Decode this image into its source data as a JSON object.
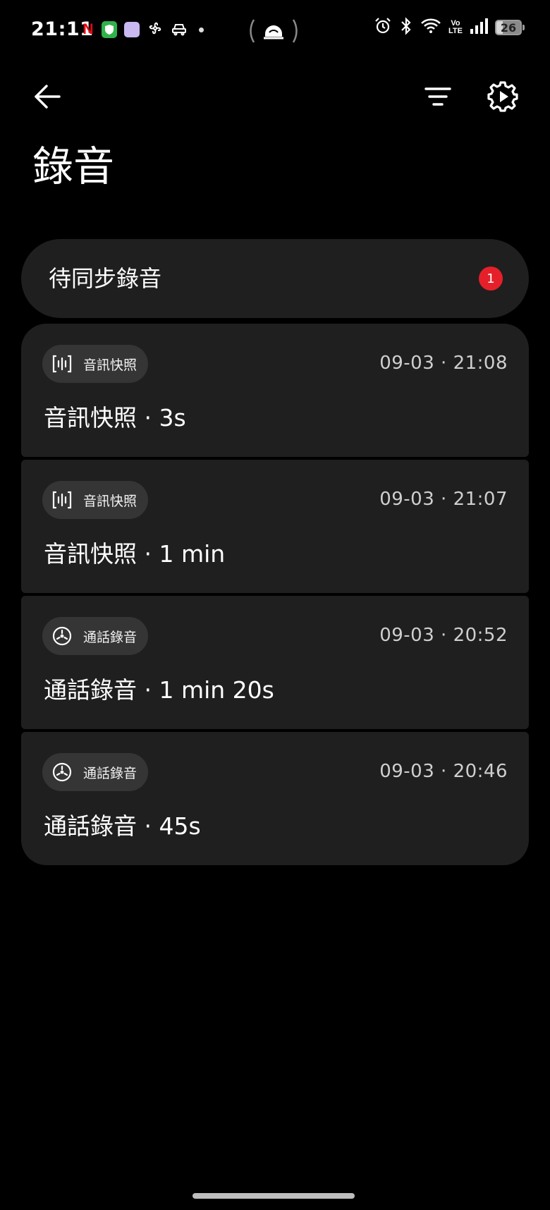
{
  "status_bar": {
    "time": "21:11",
    "netflix_glyph": "N",
    "battery_level": "26",
    "volte_label": "Vo\nLTE",
    "left_icons": [
      "netflix-icon",
      "shield-icon",
      "app-icon",
      "fan-icon",
      "car-icon",
      "dot-icon"
    ],
    "center_icon": "hotspot-icon",
    "right_icons": [
      "alarm-icon",
      "bluetooth-icon",
      "wifi-icon",
      "volte-icon",
      "signal-icon",
      "battery-icon"
    ]
  },
  "app_bar": {
    "back_icon": "arrow-left-icon",
    "filter_icon": "filter-icon",
    "settings_icon": "settings-gear-icon",
    "title": "錄音"
  },
  "pending_sync": {
    "label": "待同步錄音",
    "badge_count": "1",
    "badge_color": "#e5202a"
  },
  "recordings": [
    {
      "type_label": "音訊快照",
      "type_icon": "audio-snapshot-icon",
      "timestamp": "09-03 · 21:08",
      "title": "音訊快照 · 3s"
    },
    {
      "type_label": "音訊快照",
      "type_icon": "audio-snapshot-icon",
      "timestamp": "09-03 · 21:07",
      "title": "音訊快照 · 1 min"
    },
    {
      "type_label": "通話錄音",
      "type_icon": "call-recording-icon",
      "timestamp": "09-03 · 20:52",
      "title": "通話錄音 · 1 min 20s"
    },
    {
      "type_label": "通話錄音",
      "type_icon": "call-recording-icon",
      "timestamp": "09-03 · 20:46",
      "title": "通話錄音 · 45s"
    }
  ],
  "colors": {
    "background": "#000000",
    "card": "#1f1f1f",
    "chip": "#353535",
    "text_primary": "#ffffff",
    "text_secondary": "#cfcfcf"
  }
}
